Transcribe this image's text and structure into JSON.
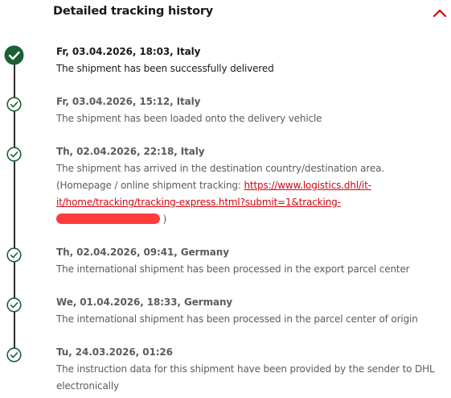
{
  "header": {
    "title": "Detailed tracking history",
    "collapse_icon": "chevron-up-icon"
  },
  "colors": {
    "accent_red": "#d40511",
    "dhl_green": "#1c5e35",
    "timeline_dark": "#2b2b2b",
    "redaction": "#ff3b3b"
  },
  "events": [
    {
      "date": "Fr, 03.04.2026, 18:03, Italy",
      "description": "The shipment has been successfully delivered",
      "icon": "check-filled-icon"
    },
    {
      "date": "Fr, 03.04.2026, 15:12, Italy",
      "description": "The shipment has been loaded onto the delivery vehicle",
      "icon": "check-outline-icon"
    },
    {
      "date": "Th, 02.04.2026, 22:18, Italy",
      "description": "The shipment has arrived in the destination country/destination area.",
      "note_prefix": "(Homepage / online shipment tracking: ",
      "link_line1": "https://www.logistics.dhl/it-",
      "link_line2": "it/home/tracking/tracking-express.html?submit=1&tracking-",
      "note_suffix": ")",
      "icon": "check-outline-icon"
    },
    {
      "date": "Th, 02.04.2026, 09:41, Germany",
      "description": "The international shipment has been processed in the export parcel center",
      "icon": "check-outline-icon"
    },
    {
      "date": "We, 01.04.2026, 18:33, Germany",
      "description": "The international shipment has been processed in the parcel center of origin",
      "icon": "check-outline-icon"
    },
    {
      "date": "Tu, 24.03.2026, 01:26",
      "description_line1": "The instruction data for this shipment have been provided by the sender to DHL",
      "description_line2": "electronically",
      "icon": "check-outline-icon"
    }
  ]
}
